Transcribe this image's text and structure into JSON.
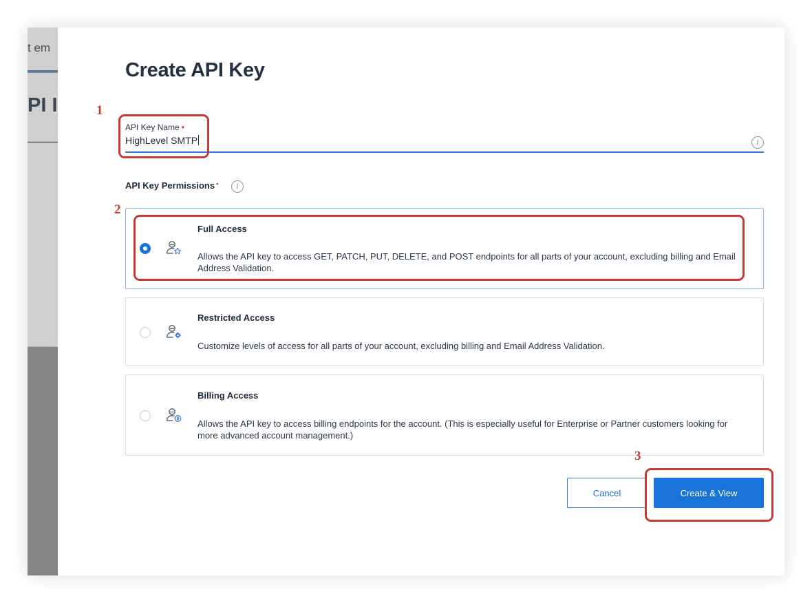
{
  "background": {
    "tab_text": "t em",
    "heading_text": "PI I"
  },
  "modal": {
    "title": "Create API Key",
    "name_field": {
      "label": "API Key Name",
      "required_mark": "•",
      "value": "HighLevel SMTP",
      "info_glyph": "i"
    },
    "permissions": {
      "label": "API Key Permissions",
      "required_mark": "•",
      "info_glyph": "i",
      "selected": "Full Access",
      "options": [
        {
          "title": "Full Access",
          "description": "Allows the API key to access GET, PATCH, PUT, DELETE, and POST endpoints for all parts of your account, excluding billing and Email Address Validation.",
          "icon": "user-star-icon"
        },
        {
          "title": "Restricted Access",
          "description": "Customize levels of access for all parts of your account, excluding billing and Email Address Validation.",
          "icon": "user-gear-icon"
        },
        {
          "title": "Billing Access",
          "description": "Allows the API key to access billing endpoints for the account. (This is especially useful for Enterprise or Partner customers looking for more advanced account management.)",
          "icon": "user-dollar-icon"
        }
      ]
    },
    "buttons": {
      "cancel": "Cancel",
      "create": "Create & View"
    }
  },
  "annotations": {
    "step1": "1",
    "step2": "2",
    "step3": "3"
  },
  "colors": {
    "accent": "#1a73d8",
    "annotation": "#c93a36",
    "required": "#c5303a"
  }
}
